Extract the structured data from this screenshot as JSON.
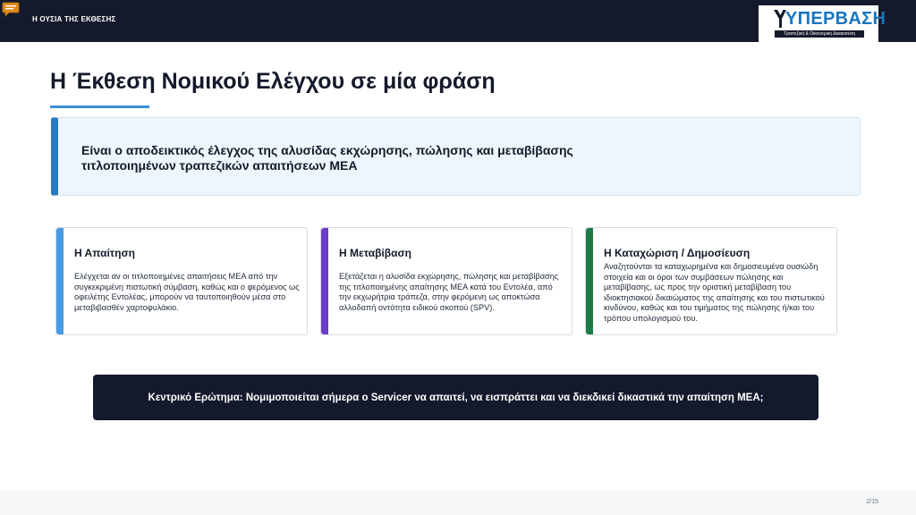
{
  "header": {
    "section_label": "Η ΟΥΣΙΑ ΤΗΣ ΕΚΘΕΣΗΣ",
    "logo": {
      "name": "ΥΠΕΡΒΑΣΗ",
      "tagline": "Τραπεζική & Οικονομική Δικαιοσύνη"
    }
  },
  "slide": {
    "title": "Η Έκθεση Νομικού Ελέγχου σε μία φράση",
    "summary": "Είναι ο αποδεικτικός έλεγχος της αλυσίδας εκχώρησης, πώλησης και μεταβίβασης τιτλοποιημένων τραπεζικών απαιτήσεων ΜΕΑ",
    "cards": [
      {
        "title": "Η Απαίτηση",
        "body": "Ελέγχεται αν οι τιτλοποιημένες απαιτήσεις ΜΕΑ από την συγκεκριμένη πιστωτική σύμβαση, καθώς και ο φερόμενος ως οφειλέτης Εντολέας, μπορούν να ταυτοποιηθούν μέσα στο μεταβιβασθέν χαρτοφυλάκιο.",
        "accent": "#4a9ae0"
      },
      {
        "title": "Η Μεταβίβαση",
        "body": "Εξετάζεται η αλυσίδα εκχώρησης, πώλησης και μεταβίβασης της τιτλοποιημένης απαίτησης ΜΕΑ κατά του Εντολέα, από την εκχωρήτρια τράπεζα, στην φερόμενη ως αποκτώσα αλλοδαπή οντότητα ειδικού σκοπού (SPV).",
        "accent": "#6a3fc8"
      },
      {
        "title": "Η Καταχώριση / Δημοσίευση",
        "body": "Αναζητούνται τα καταχωρημένα και δημοσιευμένα ουσιώδη στοιχεία και οι όροι των συμβάσεων πώλησης και μεταβίβασης, ως προς την οριστική μεταβίβαση του ιδιοκτησιακού δικαιώματος της απαίτησης και του πιστωτικού κινδύνου, καθώς και του τιμήματος της πώλησης ή/και του τρόπου υπολογισμού του.",
        "accent": "#1e7b45"
      }
    ],
    "central_question": "Κεντρικό Ερώτημα: Νομιμοποιείται σήμερα ο Servicer να απαιτεί, να εισπράττει και να διεκδικεί δικαστικά την απαίτηση ΜΕΑ;"
  },
  "footer": {
    "page_number": "2/15"
  },
  "colors": {
    "navy": "#141a2b",
    "title_rule": "#3b8fd6",
    "summary_accent": "#2b79bf",
    "summary_bg": "#eef5fc",
    "comment_icon": "#e08a1e"
  }
}
